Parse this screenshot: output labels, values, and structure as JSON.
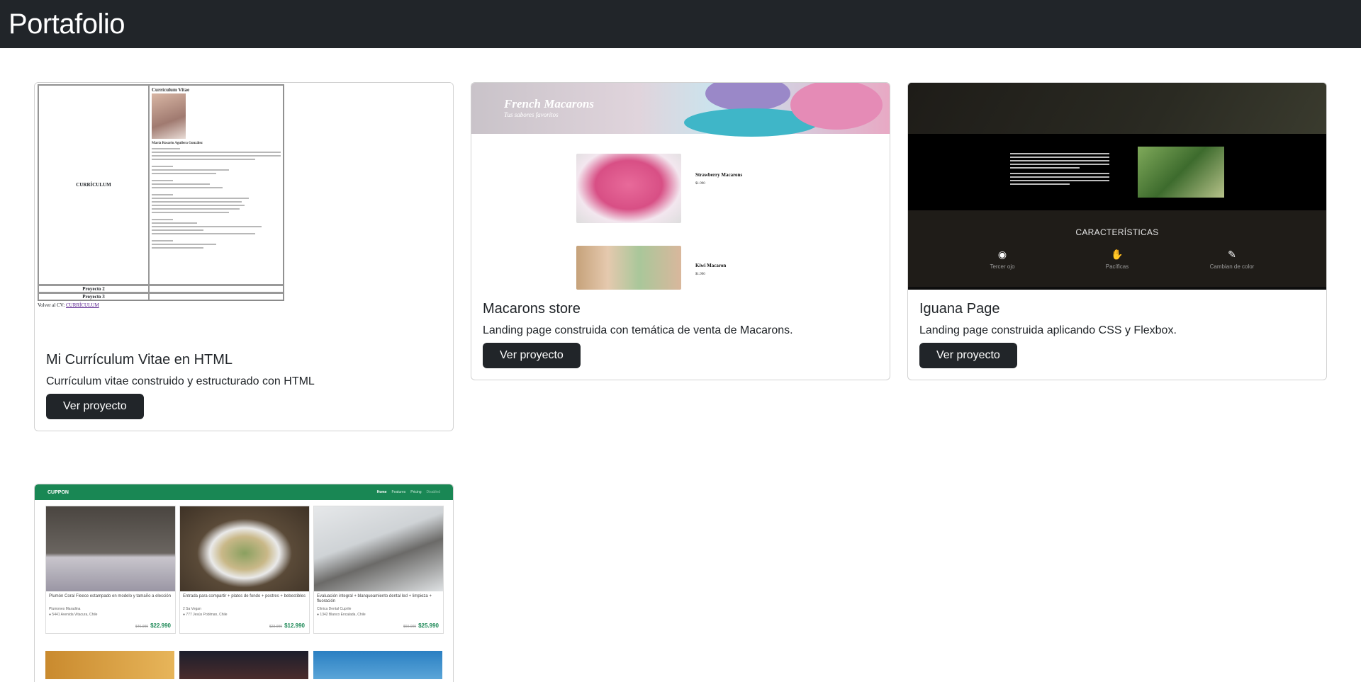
{
  "navbar": {
    "brand": "Portafolio"
  },
  "projects": [
    {
      "title": "Mi Currículum Vitae en HTML",
      "description": "Currículum vitae construido y estructurado con HTML",
      "button": "Ver proyecto",
      "preview": {
        "left_heading": "CURRÍCULUM",
        "cv_title": "Currículum Vitae",
        "name": "María Rosario Aguilera González",
        "row2": "Proyecto 2",
        "row3": "Proyecto 3",
        "back_text": "Volver al CV:",
        "back_link": "CURRÍCULUM"
      }
    },
    {
      "title": "Macarons store",
      "description": "Landing page construida con temática de venta de Macarons.",
      "button": "Ver proyecto",
      "preview": {
        "hero_title": "French Macarons",
        "hero_subtitle": "Tus sabores favoritos",
        "item1": "Strawberry Macarons",
        "item1_price": "$1.990",
        "item2": "Kiwi Macaron",
        "item2_price": "$1.990"
      }
    },
    {
      "title": "Iguana Page",
      "description": "Landing page construida aplicando CSS y Flexbox.",
      "button": "Ver proyecto",
      "preview": {
        "features_title": "CARACTERÍSTICAS",
        "feature1": "Tercer ojo",
        "feature2": "Pacíficas",
        "feature3": "Cambian de color"
      }
    },
    {
      "preview": {
        "brand": "CUPPON",
        "nav": [
          "Home",
          "Features",
          "Pricing",
          "Disabled"
        ],
        "deals": [
          {
            "title": "Plumón Coral Fleece estampado en modelo y tamaño a elección",
            "shop": "Plumones Maradina",
            "address": "5441 Avenida Vitacura, Chile",
            "old": "$46.990",
            "price": "$22.990",
            "color": "#5a5550"
          },
          {
            "title": "Entrada para compartir + platos de fondo + postres + bebestibles",
            "shop": "2 Sa Vegan",
            "address": "777 Jesús Poblman, Chile",
            "old": "$23.990",
            "price": "$12.990",
            "color": "#6e5a45"
          },
          {
            "title": "Evaluación integral + blanqueamiento dental led + limpieza + fluoración",
            "shop": "Clínica Dental Cuprile",
            "address": "1342 Blanco Encalada, Chile",
            "old": "$60.000",
            "price": "$25.990",
            "color": "#c9cdd1"
          }
        ]
      }
    }
  ]
}
